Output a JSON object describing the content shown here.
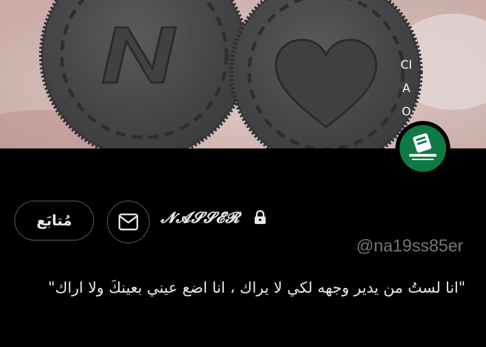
{
  "banner": {
    "vertical_text": "CIAO",
    "cookie_left_letter": "N",
    "cookie_left_icon": "letter-n-cookie",
    "cookie_right_icon": "heart-cookie"
  },
  "avatar": {
    "icon": "green-logo-avatar",
    "color": "#0e7a43"
  },
  "actions": {
    "follow_label": "مُتابَع",
    "message_icon": "envelope-icon"
  },
  "profile": {
    "display_name": "𝓝𝓐𝓢𝓢𝓔𝓡",
    "lock_icon": "lock-icon",
    "handle": "@na19ss85er",
    "bio": "\"انا لستُ من يدير وجهه لكي لا يراك ، انا اضع عيني بعينكَ ولا اراك\""
  },
  "colors": {
    "background": "#000000",
    "text_primary": "#e7e9ea",
    "text_secondary": "#71767b",
    "border": "#5b6167"
  }
}
